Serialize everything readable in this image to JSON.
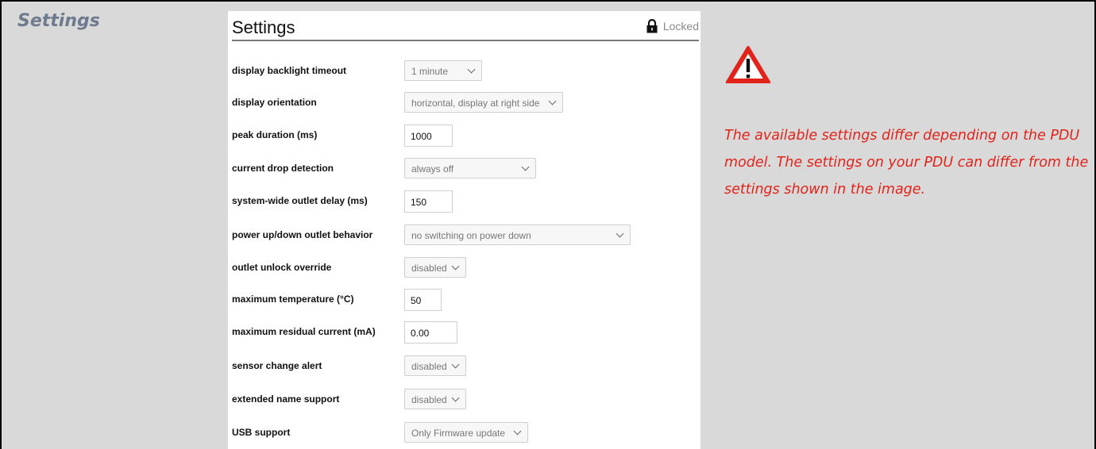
{
  "sidebar": {
    "title": "Settings"
  },
  "panel": {
    "title": "Settings",
    "lock_status": "Locked",
    "lock_icon": "padlock-icon",
    "rows": [
      {
        "label": "display backlight timeout",
        "type": "select",
        "value": "1 minute"
      },
      {
        "label": "display orientation",
        "type": "select",
        "value": "horizontal, display at right side"
      },
      {
        "label": "peak duration (ms)",
        "type": "input",
        "value": "1000"
      },
      {
        "label": "current drop detection",
        "type": "select",
        "value": "always off"
      },
      {
        "label": "system-wide outlet delay (ms)",
        "type": "input",
        "value": "150"
      },
      {
        "label": "power up/down outlet behavior",
        "type": "select",
        "value": "no switching on power down"
      },
      {
        "label": "outlet unlock override",
        "type": "select",
        "value": "disabled"
      },
      {
        "label": "maximum temperature (°C)",
        "type": "input",
        "value": "50"
      },
      {
        "label": "maximum residual current (mA)",
        "type": "input",
        "value": "0.00"
      },
      {
        "label": "sensor change alert",
        "type": "select",
        "value": "disabled"
      },
      {
        "label": "extended name support",
        "type": "select",
        "value": "disabled"
      },
      {
        "label": "USB support",
        "type": "select",
        "value": "Only Firmware update"
      }
    ]
  },
  "note": {
    "icon": "warning-triangle-icon",
    "text": "The available settings differ depending on the PDU model. The settings on your PDU can differ from the settings shown in the image.",
    "color": "#e2231a"
  }
}
